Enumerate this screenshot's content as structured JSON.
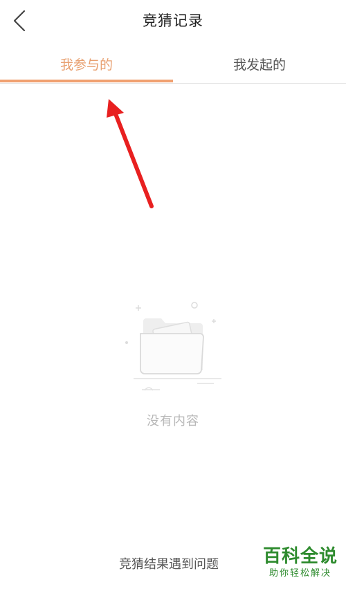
{
  "header": {
    "title": "竞猜记录",
    "back_icon": "chevron-left-icon"
  },
  "tabs": [
    {
      "label": "我参与的",
      "active": true
    },
    {
      "label": "我发起的",
      "active": false
    }
  ],
  "colors": {
    "accent": "#f0a070",
    "active_tab_text": "#e8a070",
    "annotation_arrow": "#e82020",
    "watermark": "#2e8b2e"
  },
  "empty_state": {
    "icon": "empty-folder-icon",
    "text": "没有内容"
  },
  "footer": {
    "link_label": "竞猜结果遇到问题"
  },
  "watermark": {
    "main": "百科全说",
    "sub": "助你轻松解决"
  }
}
